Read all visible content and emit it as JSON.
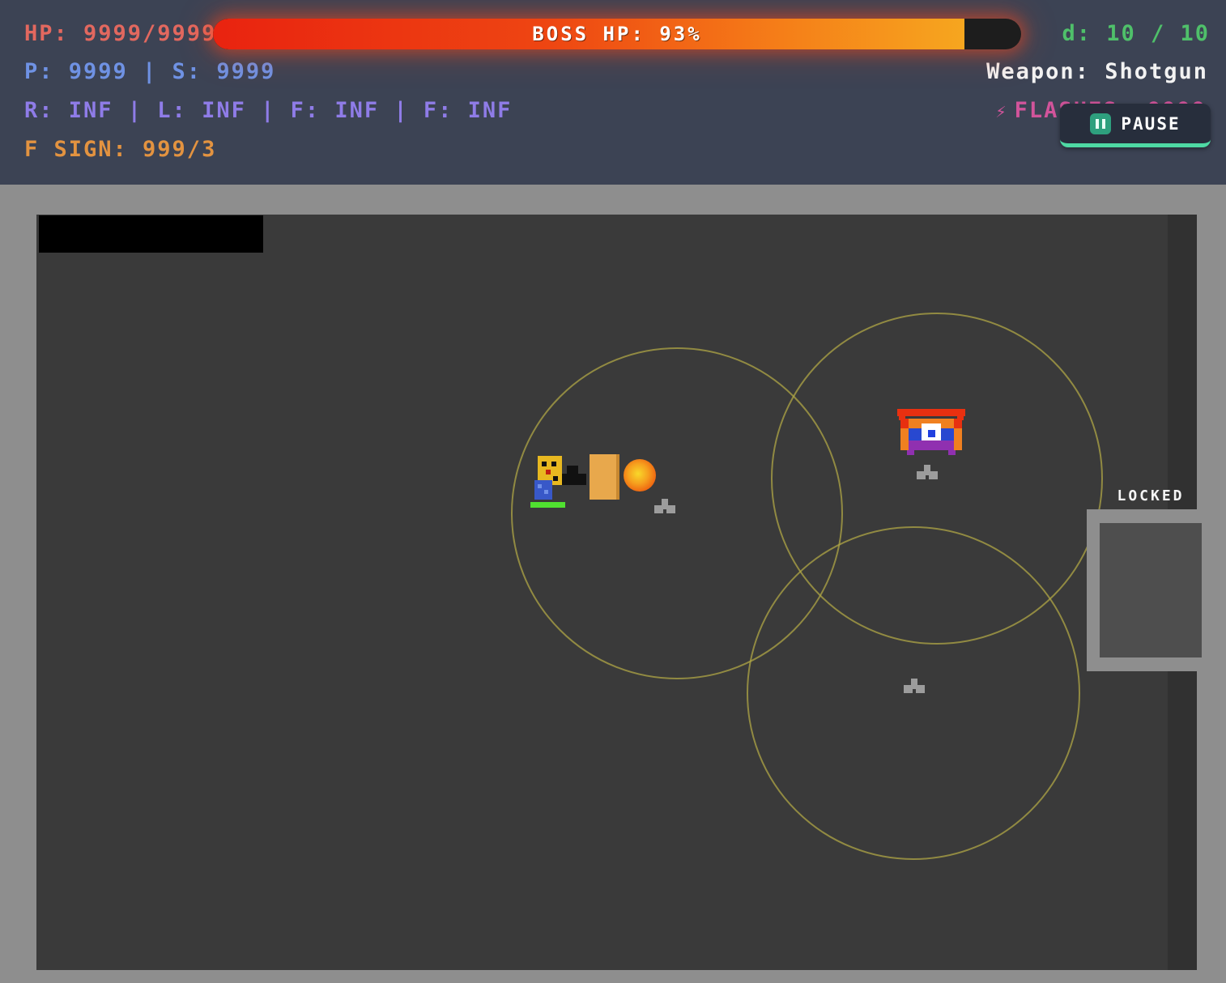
{
  "hud": {
    "hp": {
      "text": "HP: 9999/9999"
    },
    "boss_bar": {
      "text": "BOSS HP: 93%",
      "percent": 93
    },
    "speed": {
      "text": "d: 10 / 10"
    },
    "ps": {
      "text": "P: 9999 | S: 9999"
    },
    "weapon": {
      "text": "Weapon: Shotgun"
    },
    "ammo": {
      "text": "R: INF | L: INF | F: INF | F: INF"
    },
    "flashes": {
      "icon": "lightning-icon",
      "glyph": "⚡",
      "text": "FLASHES: 9999"
    },
    "fsign": {
      "text": "F SIGN: 999/3"
    },
    "pause": {
      "label": "PAUSE"
    }
  },
  "game": {
    "locked": "LOCKED"
  },
  "colors": {
    "hud_bg": "#3c4354",
    "hp_text": "#e2685f",
    "speed_text": "#4fc06a",
    "ps_text": "#6f92e4",
    "weapon_text": "#f2f2f2",
    "ammo_text": "#8f7ce8",
    "flashes_text": "#d2549b",
    "fsign_text": "#e39340",
    "boss_fill_start": "#e92310",
    "boss_fill_end": "#f6a61f",
    "pause_accent": "#4ed9a4",
    "playfield_bg": "#3a3a3a",
    "frame_bg": "#8e8e8e",
    "range_circle": "#afa546",
    "player_hp_bar": "#50e030"
  }
}
